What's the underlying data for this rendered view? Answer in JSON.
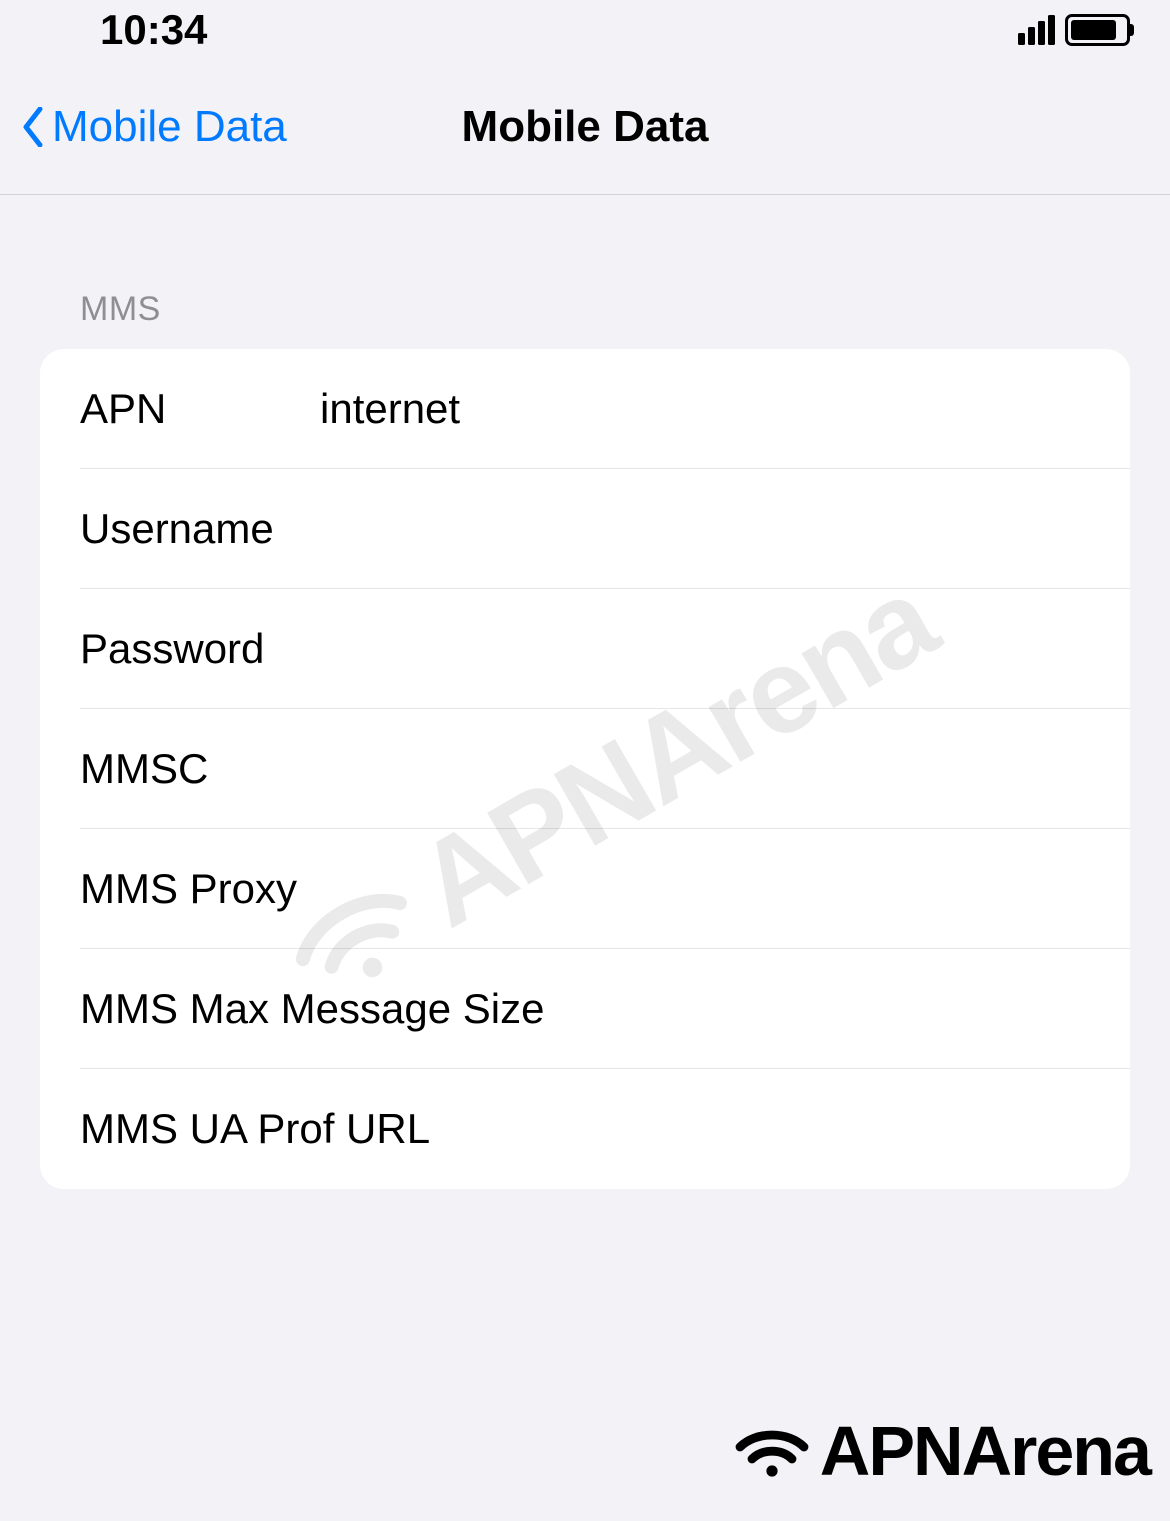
{
  "status_bar": {
    "time": "10:34"
  },
  "nav": {
    "back_label": "Mobile Data",
    "title": "Mobile Data"
  },
  "section": {
    "header": "MMS",
    "fields": [
      {
        "label": "APN",
        "value": "internet"
      },
      {
        "label": "Username",
        "value": ""
      },
      {
        "label": "Password",
        "value": ""
      },
      {
        "label": "MMSC",
        "value": ""
      },
      {
        "label": "MMS Proxy",
        "value": ""
      },
      {
        "label": "MMS Max Message Size",
        "value": ""
      },
      {
        "label": "MMS UA Prof URL",
        "value": ""
      }
    ]
  },
  "branding": {
    "watermark": "APNArena",
    "footer": "APNArena"
  }
}
